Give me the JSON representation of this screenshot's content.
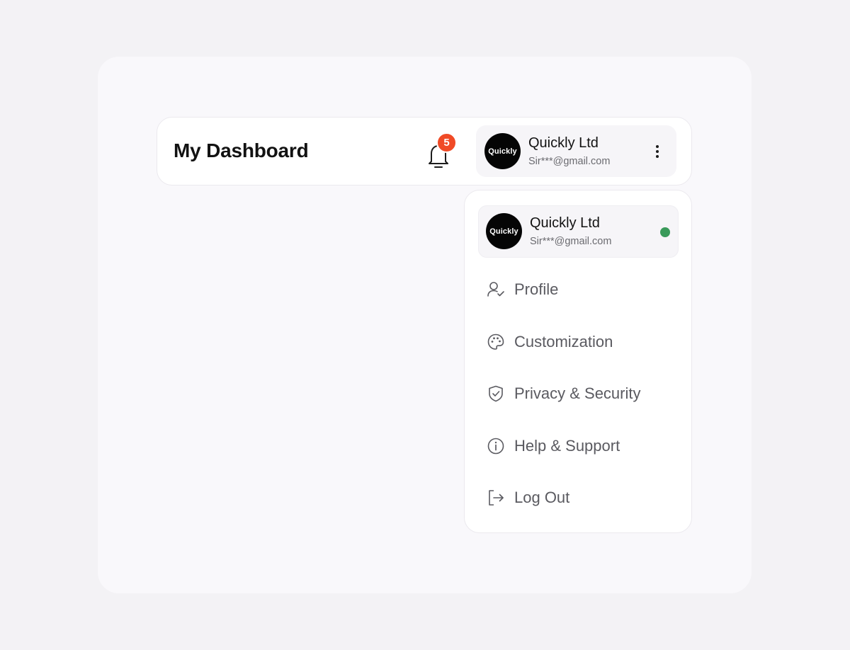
{
  "header": {
    "title": "My Dashboard",
    "notification_count": "5",
    "account": {
      "name": "Quickly Ltd",
      "email": "Sir***@gmail.com",
      "logo_text": "Quickly"
    }
  },
  "dropdown": {
    "account": {
      "name": "Quickly Ltd",
      "email": "Sir***@gmail.com",
      "logo_text": "Quickly",
      "status": "online"
    },
    "items": [
      {
        "label": "Profile",
        "icon": "user-check-icon"
      },
      {
        "label": "Customization",
        "icon": "palette-icon"
      },
      {
        "label": "Privacy & Security",
        "icon": "shield-check-icon"
      },
      {
        "label": "Help & Support",
        "icon": "info-icon"
      },
      {
        "label": "Log Out",
        "icon": "logout-icon"
      }
    ]
  },
  "colors": {
    "badge": "#f04a26",
    "status_online": "#3a9a5a",
    "avatar_bg": "#050505",
    "menu_text": "#5a5a60"
  }
}
